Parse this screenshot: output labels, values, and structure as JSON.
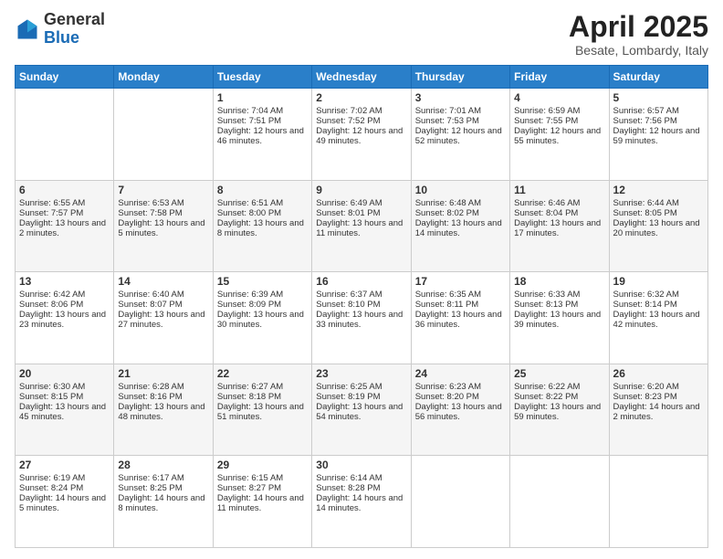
{
  "header": {
    "logo_general": "General",
    "logo_blue": "Blue",
    "month_title": "April 2025",
    "location": "Besate, Lombardy, Italy"
  },
  "days_of_week": [
    "Sunday",
    "Monday",
    "Tuesday",
    "Wednesday",
    "Thursday",
    "Friday",
    "Saturday"
  ],
  "weeks": [
    [
      {
        "day": "",
        "sunrise": "",
        "sunset": "",
        "daylight": ""
      },
      {
        "day": "",
        "sunrise": "",
        "sunset": "",
        "daylight": ""
      },
      {
        "day": "1",
        "sunrise": "Sunrise: 7:04 AM",
        "sunset": "Sunset: 7:51 PM",
        "daylight": "Daylight: 12 hours and 46 minutes."
      },
      {
        "day": "2",
        "sunrise": "Sunrise: 7:02 AM",
        "sunset": "Sunset: 7:52 PM",
        "daylight": "Daylight: 12 hours and 49 minutes."
      },
      {
        "day": "3",
        "sunrise": "Sunrise: 7:01 AM",
        "sunset": "Sunset: 7:53 PM",
        "daylight": "Daylight: 12 hours and 52 minutes."
      },
      {
        "day": "4",
        "sunrise": "Sunrise: 6:59 AM",
        "sunset": "Sunset: 7:55 PM",
        "daylight": "Daylight: 12 hours and 55 minutes."
      },
      {
        "day": "5",
        "sunrise": "Sunrise: 6:57 AM",
        "sunset": "Sunset: 7:56 PM",
        "daylight": "Daylight: 12 hours and 59 minutes."
      }
    ],
    [
      {
        "day": "6",
        "sunrise": "Sunrise: 6:55 AM",
        "sunset": "Sunset: 7:57 PM",
        "daylight": "Daylight: 13 hours and 2 minutes."
      },
      {
        "day": "7",
        "sunrise": "Sunrise: 6:53 AM",
        "sunset": "Sunset: 7:58 PM",
        "daylight": "Daylight: 13 hours and 5 minutes."
      },
      {
        "day": "8",
        "sunrise": "Sunrise: 6:51 AM",
        "sunset": "Sunset: 8:00 PM",
        "daylight": "Daylight: 13 hours and 8 minutes."
      },
      {
        "day": "9",
        "sunrise": "Sunrise: 6:49 AM",
        "sunset": "Sunset: 8:01 PM",
        "daylight": "Daylight: 13 hours and 11 minutes."
      },
      {
        "day": "10",
        "sunrise": "Sunrise: 6:48 AM",
        "sunset": "Sunset: 8:02 PM",
        "daylight": "Daylight: 13 hours and 14 minutes."
      },
      {
        "day": "11",
        "sunrise": "Sunrise: 6:46 AM",
        "sunset": "Sunset: 8:04 PM",
        "daylight": "Daylight: 13 hours and 17 minutes."
      },
      {
        "day": "12",
        "sunrise": "Sunrise: 6:44 AM",
        "sunset": "Sunset: 8:05 PM",
        "daylight": "Daylight: 13 hours and 20 minutes."
      }
    ],
    [
      {
        "day": "13",
        "sunrise": "Sunrise: 6:42 AM",
        "sunset": "Sunset: 8:06 PM",
        "daylight": "Daylight: 13 hours and 23 minutes."
      },
      {
        "day": "14",
        "sunrise": "Sunrise: 6:40 AM",
        "sunset": "Sunset: 8:07 PM",
        "daylight": "Daylight: 13 hours and 27 minutes."
      },
      {
        "day": "15",
        "sunrise": "Sunrise: 6:39 AM",
        "sunset": "Sunset: 8:09 PM",
        "daylight": "Daylight: 13 hours and 30 minutes."
      },
      {
        "day": "16",
        "sunrise": "Sunrise: 6:37 AM",
        "sunset": "Sunset: 8:10 PM",
        "daylight": "Daylight: 13 hours and 33 minutes."
      },
      {
        "day": "17",
        "sunrise": "Sunrise: 6:35 AM",
        "sunset": "Sunset: 8:11 PM",
        "daylight": "Daylight: 13 hours and 36 minutes."
      },
      {
        "day": "18",
        "sunrise": "Sunrise: 6:33 AM",
        "sunset": "Sunset: 8:13 PM",
        "daylight": "Daylight: 13 hours and 39 minutes."
      },
      {
        "day": "19",
        "sunrise": "Sunrise: 6:32 AM",
        "sunset": "Sunset: 8:14 PM",
        "daylight": "Daylight: 13 hours and 42 minutes."
      }
    ],
    [
      {
        "day": "20",
        "sunrise": "Sunrise: 6:30 AM",
        "sunset": "Sunset: 8:15 PM",
        "daylight": "Daylight: 13 hours and 45 minutes."
      },
      {
        "day": "21",
        "sunrise": "Sunrise: 6:28 AM",
        "sunset": "Sunset: 8:16 PM",
        "daylight": "Daylight: 13 hours and 48 minutes."
      },
      {
        "day": "22",
        "sunrise": "Sunrise: 6:27 AM",
        "sunset": "Sunset: 8:18 PM",
        "daylight": "Daylight: 13 hours and 51 minutes."
      },
      {
        "day": "23",
        "sunrise": "Sunrise: 6:25 AM",
        "sunset": "Sunset: 8:19 PM",
        "daylight": "Daylight: 13 hours and 54 minutes."
      },
      {
        "day": "24",
        "sunrise": "Sunrise: 6:23 AM",
        "sunset": "Sunset: 8:20 PM",
        "daylight": "Daylight: 13 hours and 56 minutes."
      },
      {
        "day": "25",
        "sunrise": "Sunrise: 6:22 AM",
        "sunset": "Sunset: 8:22 PM",
        "daylight": "Daylight: 13 hours and 59 minutes."
      },
      {
        "day": "26",
        "sunrise": "Sunrise: 6:20 AM",
        "sunset": "Sunset: 8:23 PM",
        "daylight": "Daylight: 14 hours and 2 minutes."
      }
    ],
    [
      {
        "day": "27",
        "sunrise": "Sunrise: 6:19 AM",
        "sunset": "Sunset: 8:24 PM",
        "daylight": "Daylight: 14 hours and 5 minutes."
      },
      {
        "day": "28",
        "sunrise": "Sunrise: 6:17 AM",
        "sunset": "Sunset: 8:25 PM",
        "daylight": "Daylight: 14 hours and 8 minutes."
      },
      {
        "day": "29",
        "sunrise": "Sunrise: 6:15 AM",
        "sunset": "Sunset: 8:27 PM",
        "daylight": "Daylight: 14 hours and 11 minutes."
      },
      {
        "day": "30",
        "sunrise": "Sunrise: 6:14 AM",
        "sunset": "Sunset: 8:28 PM",
        "daylight": "Daylight: 14 hours and 14 minutes."
      },
      {
        "day": "",
        "sunrise": "",
        "sunset": "",
        "daylight": ""
      },
      {
        "day": "",
        "sunrise": "",
        "sunset": "",
        "daylight": ""
      },
      {
        "day": "",
        "sunrise": "",
        "sunset": "",
        "daylight": ""
      }
    ]
  ]
}
